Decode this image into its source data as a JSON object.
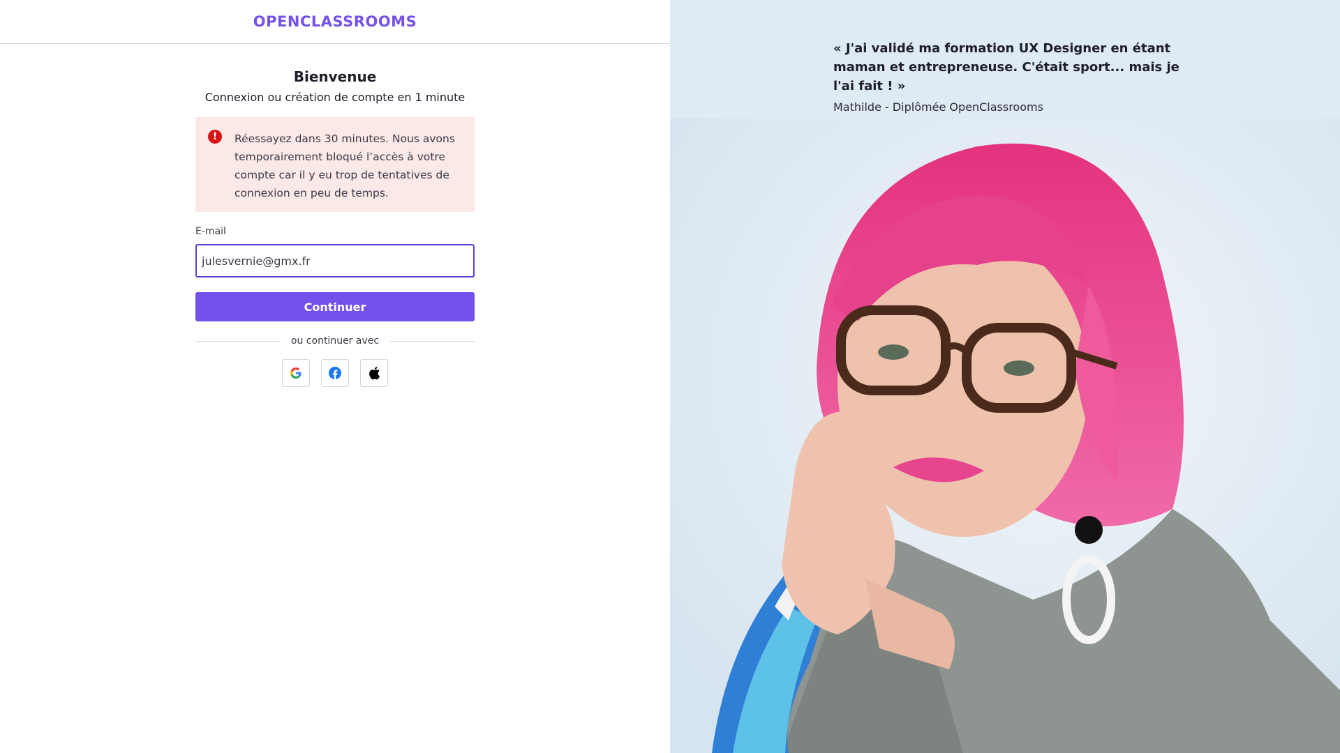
{
  "header": {
    "logo_text": "OPENCLASSROOMS"
  },
  "login": {
    "title": "Bienvenue",
    "subtitle": "Connexion ou création de compte en 1 minute",
    "alert": {
      "icon": "error-icon",
      "message": "Réessayez dans 30 minutes. Nous avons temporairement bloqué l’accès à votre compte car il y eu trop de tentatives de connexion en peu de temps."
    },
    "email_label": "E-mail",
    "email_value": "julesvernie@gmx.fr",
    "continue_label": "Continuer",
    "divider_text": "ou continuer avec",
    "social": [
      "google-icon",
      "facebook-icon",
      "apple-icon"
    ]
  },
  "testimonial": {
    "quote": "« J'ai validé ma formation UX Designer en étant maman et entrepreneuse. C'était sport... mais je l'ai fait ! »",
    "author": "Mathilde - Diplômée OpenClassrooms"
  },
  "colors": {
    "brand": "#7451eb",
    "input_focus": "#5b3fd6",
    "alert_bg": "#fbe9e7",
    "alert_icon": "#d91414",
    "right_bg": "#deeaf4"
  }
}
